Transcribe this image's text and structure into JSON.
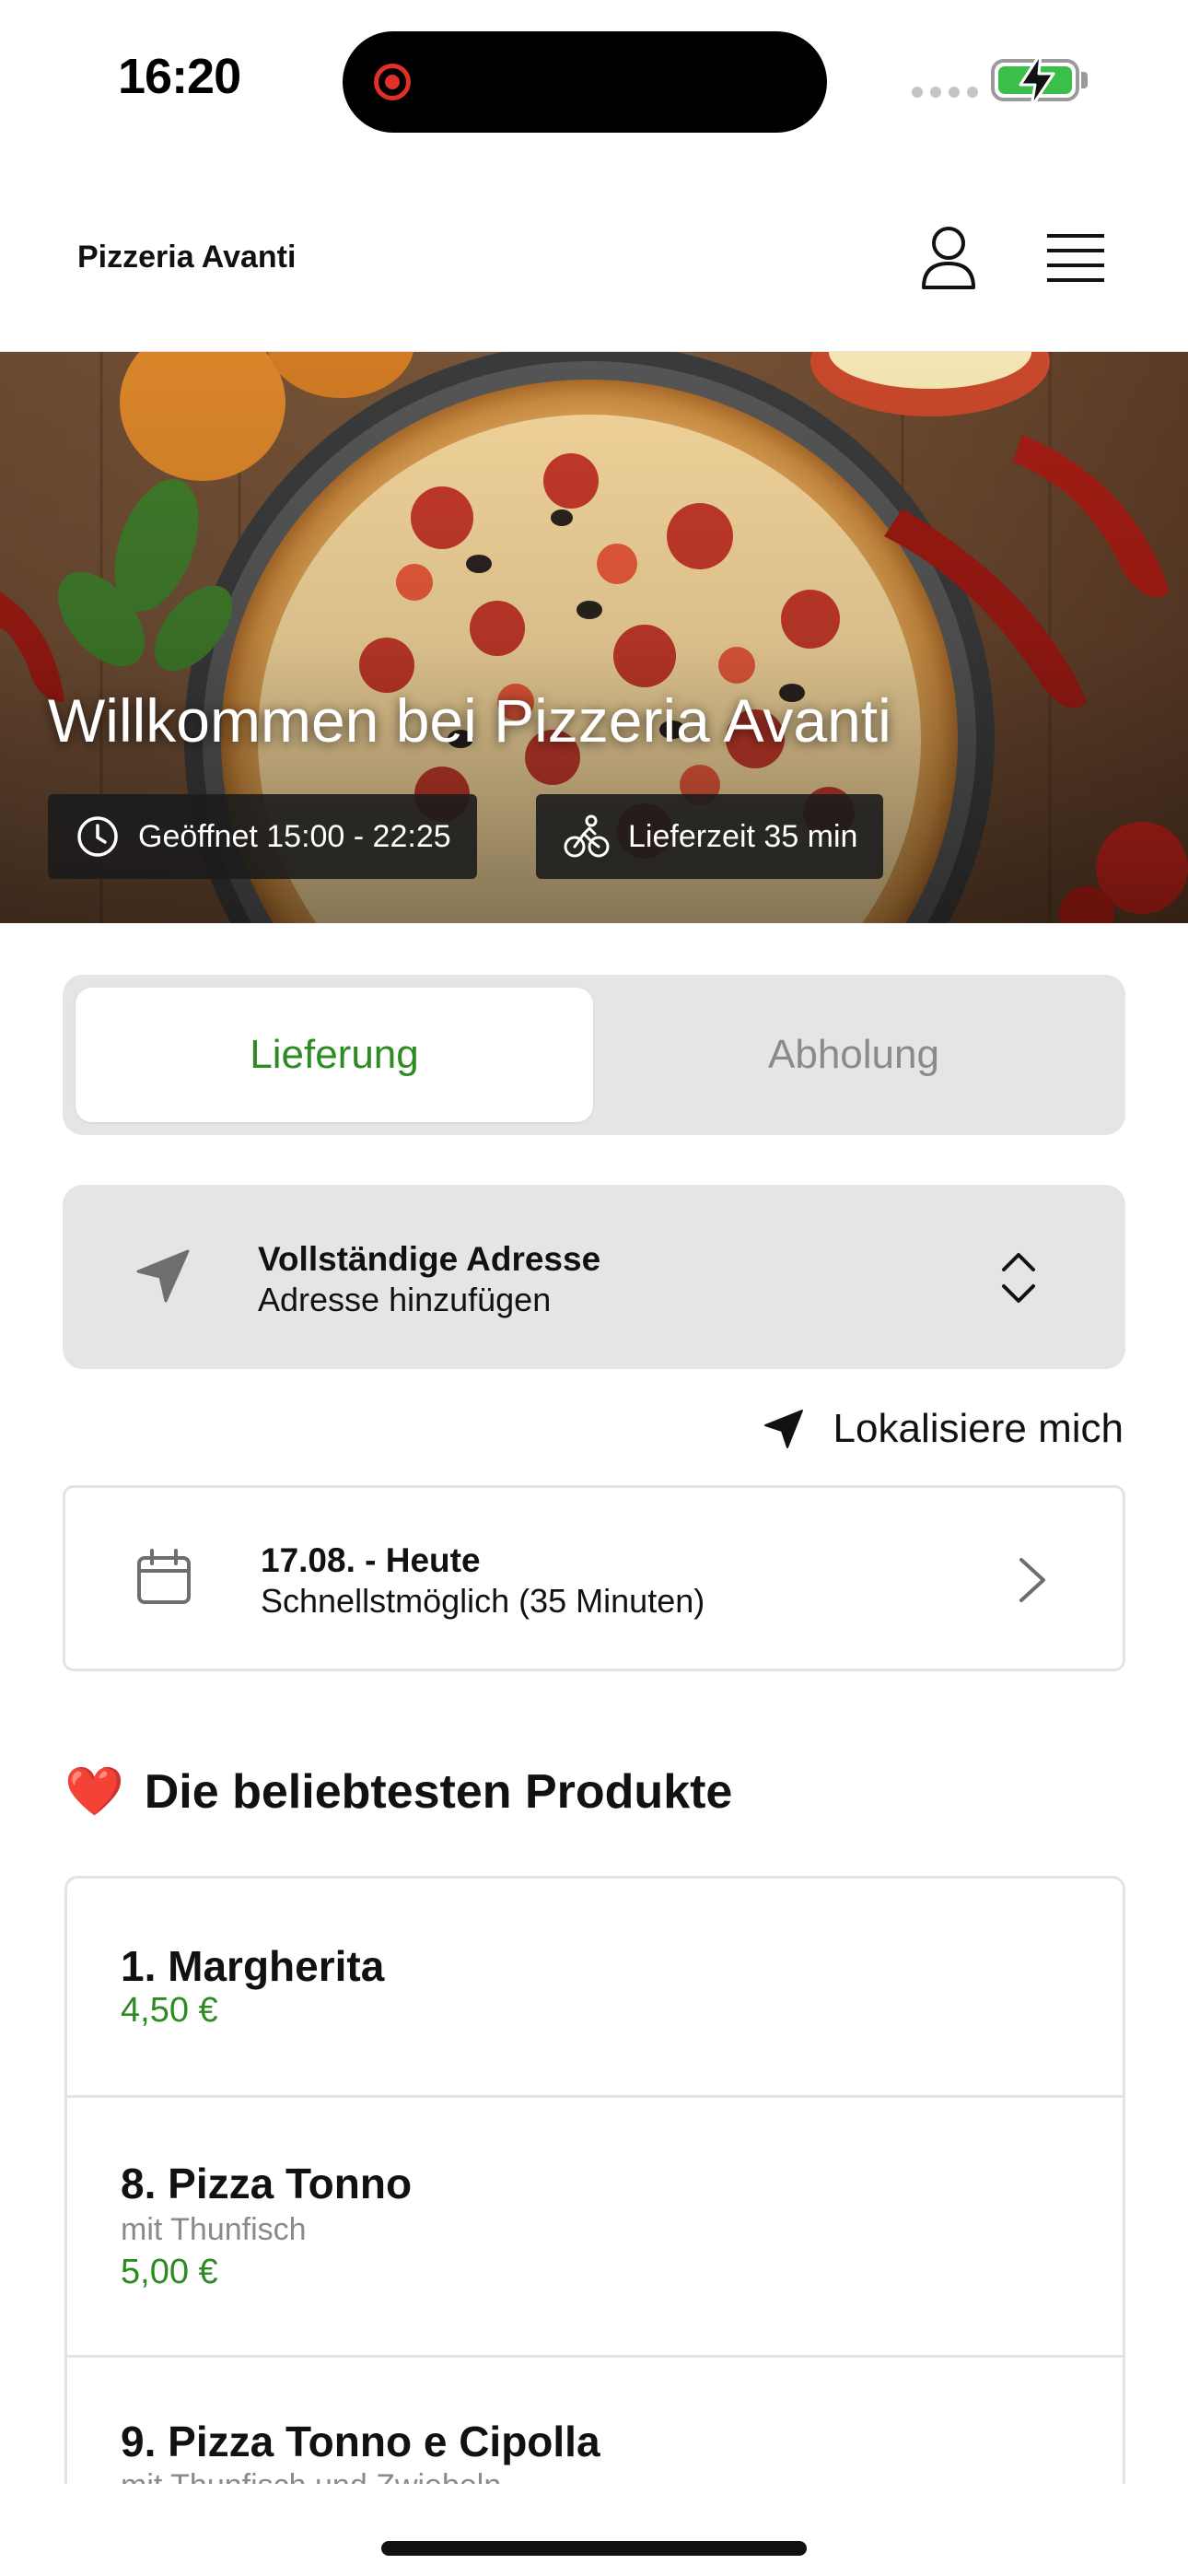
{
  "status_bar": {
    "time": "16:20",
    "battery_color": "#3bbf4a",
    "recording_indicator_color": "#e0302a"
  },
  "header": {
    "brand": "Pizzeria Avanti",
    "user_icon": "person-icon",
    "menu_icon": "hamburger-menu-icon"
  },
  "hero": {
    "title": "Willkommen bei Pizzeria Avanti",
    "open_hours": "Geöffnet 15:00 - 22:25",
    "delivery_time": "Lieferzeit 35 min"
  },
  "order_mode": {
    "options": [
      "Lieferung",
      "Abholung"
    ],
    "selected": "Lieferung",
    "active_color": "#2e8a22"
  },
  "address": {
    "title": "Vollständige Adresse",
    "placeholder": "Adresse hinzufügen"
  },
  "locate_me": "Lokalisiere mich",
  "delivery_date": {
    "title": "17.08. - Heute",
    "subtitle": "Schnellstmöglich (35 Minuten)"
  },
  "popular": {
    "emoji": "❤️",
    "title": "Die beliebtesten Produkte",
    "products": [
      {
        "name": "1. Margherita",
        "description": "",
        "price": "4,50 €"
      },
      {
        "name": "8. Pizza Tonno",
        "description": "mit Thunfisch",
        "price": "5,00 €"
      },
      {
        "name": "9. Pizza Tonno e Cipolla",
        "description": "mit Thunfisch und Zwiebeln",
        "price": ""
      }
    ]
  },
  "colors": {
    "accent_green": "#2e8a22",
    "panel_gray": "#e5e5e5",
    "border_gray": "#e3e3e3"
  }
}
